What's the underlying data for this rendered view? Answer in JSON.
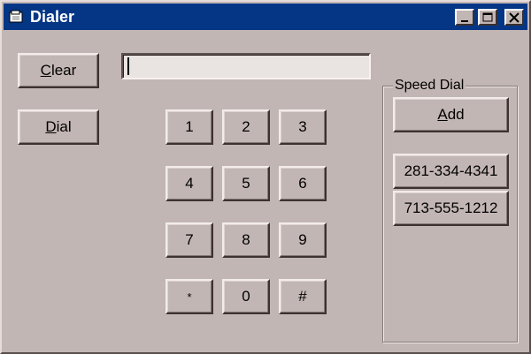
{
  "window": {
    "title": "Dialer"
  },
  "actions": {
    "clear_mnemonic": "C",
    "clear_rest": "lear",
    "dial_mnemonic": "D",
    "dial_rest": "ial"
  },
  "number_field": {
    "value": ""
  },
  "keypad": [
    "1",
    "2",
    "3",
    "4",
    "5",
    "6",
    "7",
    "8",
    "9",
    "*",
    "0",
    "#"
  ],
  "speed_dial": {
    "label": "Speed Dial",
    "add_mnemonic": "A",
    "add_rest": "dd",
    "entries": [
      "281-334-4341",
      "713-555-1212"
    ]
  },
  "colors": {
    "titlebar": "#043685",
    "face": "#c2b6b4"
  }
}
